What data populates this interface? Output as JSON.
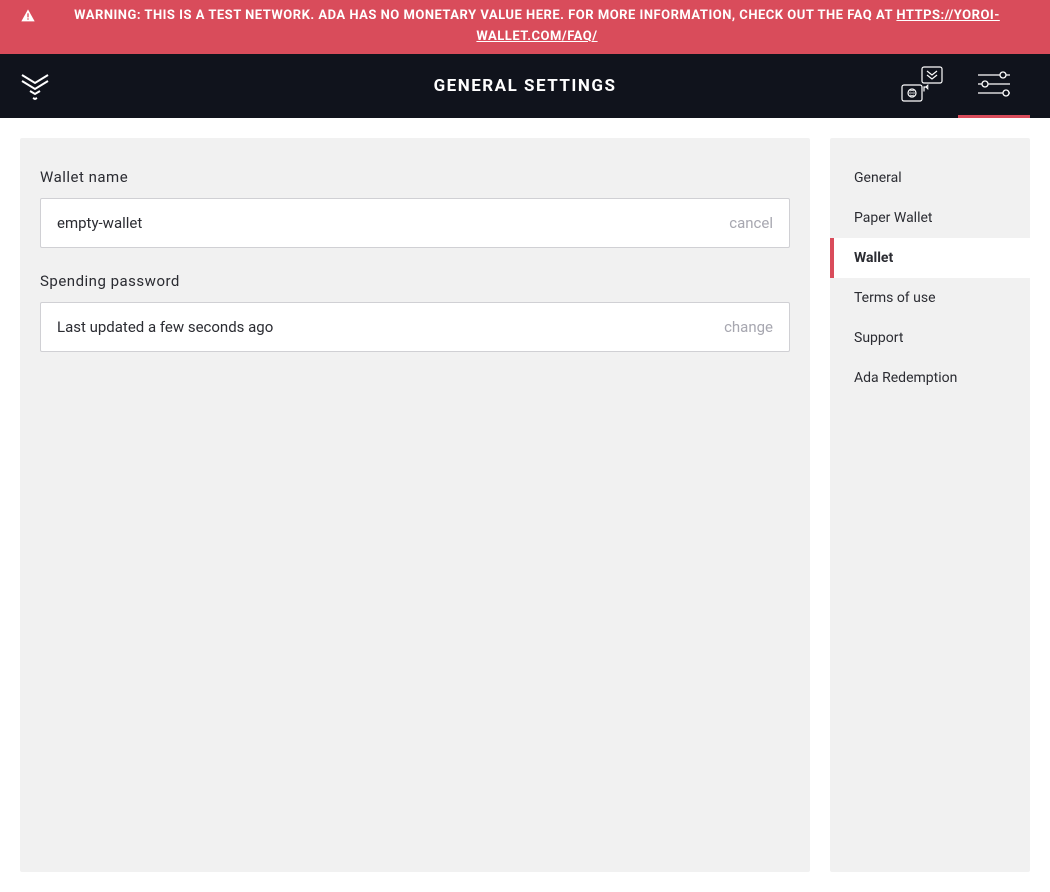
{
  "banner": {
    "warning_text": "WARNING: THIS IS A TEST NETWORK. ADA HAS NO MONETARY VALUE HERE. FOR MORE INFORMATION, CHECK OUT THE FAQ AT ",
    "faq_link_text": "HTTPS://YOROI-WALLET.COM/FAQ/"
  },
  "header": {
    "title": "GENERAL SETTINGS"
  },
  "wallet_name": {
    "label": "Wallet name",
    "value": "empty-wallet",
    "action": "cancel"
  },
  "spending_password": {
    "label": "Spending password",
    "status": "Last updated a few seconds ago",
    "action": "change"
  },
  "sidebar": {
    "items": [
      {
        "label": "General",
        "active": false
      },
      {
        "label": "Paper Wallet",
        "active": false
      },
      {
        "label": "Wallet",
        "active": true
      },
      {
        "label": "Terms of use",
        "active": false
      },
      {
        "label": "Support",
        "active": false
      },
      {
        "label": "Ada Redemption",
        "active": false
      }
    ]
  },
  "colors": {
    "primary": "#D94C5B",
    "dark": "#10131C",
    "panel": "#F1F1F1"
  }
}
